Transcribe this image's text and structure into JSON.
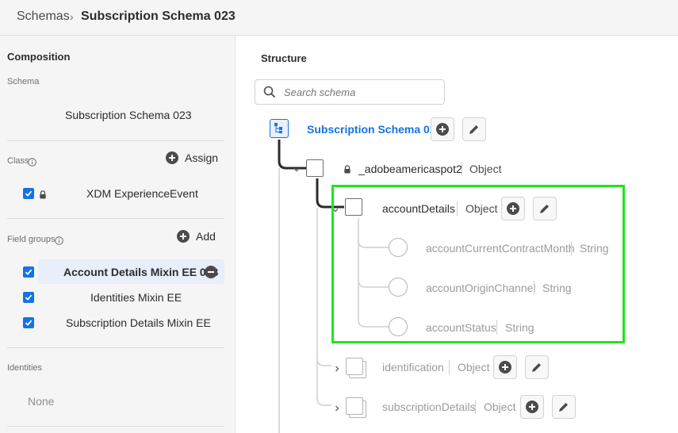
{
  "breadcrumb": {
    "parent": "Schemas",
    "separator": "›",
    "current": "Subscription Schema 023"
  },
  "composition": {
    "title": "Composition",
    "schema_label": "Schema",
    "schema_name": "Subscription Schema 023",
    "class_label": "Class",
    "assign_label": "Assign",
    "class_name": "XDM ExperienceEvent",
    "field_groups_label": "Field groups",
    "add_label": "Add",
    "field_groups": [
      "Account Details Mixin EE 023",
      "Identities Mixin EE",
      "Subscription Details Mixin EE"
    ],
    "identities_label": "Identities",
    "identities_value": "None"
  },
  "structure": {
    "title": "Structure",
    "search_placeholder": "Search schema",
    "root": "Subscription Schema 023",
    "nodes": {
      "tenant": {
        "name": "_adobeamericaspot2",
        "type": "Object"
      },
      "accountDetails": {
        "name": "accountDetails",
        "type": "Object"
      },
      "f1": {
        "name": "accountCurrentContractMonth",
        "type": "String"
      },
      "f2": {
        "name": "accountOriginChannel",
        "type": "String"
      },
      "f3": {
        "name": "accountStatus",
        "type": "String"
      },
      "identification": {
        "name": "identification",
        "type": "Object"
      },
      "subscriptionDetails": {
        "name": "subscriptionDetails",
        "type": "Object"
      }
    }
  },
  "colors": {
    "accent": "#1473e6",
    "highlight": "#1ee51e"
  }
}
